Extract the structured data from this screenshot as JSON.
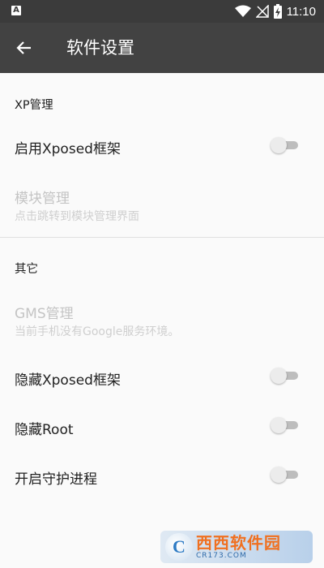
{
  "status_bar": {
    "left_icon_label": "A",
    "time": "11:10",
    "icons": [
      "wifi-icon",
      "signal-off-icon",
      "battery-charging-icon"
    ]
  },
  "toolbar": {
    "back_icon": "arrow-left-icon",
    "title": "软件设置"
  },
  "sections": [
    {
      "header": "XP管理",
      "items": [
        {
          "title": "启用Xposed框架",
          "type": "switch",
          "checked": false,
          "enabled": true
        },
        {
          "title": "模块管理",
          "subtitle": "点击跳转到模块管理界面",
          "type": "link",
          "enabled": false
        }
      ]
    },
    {
      "header": "其它",
      "items": [
        {
          "title": "GMS管理",
          "subtitle": "当前手机没有Google服务环境。",
          "type": "link",
          "enabled": false
        },
        {
          "title": "隐藏Xposed框架",
          "type": "switch",
          "checked": false,
          "enabled": true
        },
        {
          "title": "隐藏Root",
          "type": "switch",
          "checked": false,
          "enabled": true
        },
        {
          "title": "开启守护进程",
          "type": "switch",
          "checked": false,
          "enabled": true
        }
      ]
    }
  ],
  "watermark": {
    "logo_letter": "C",
    "text": "西西软件园",
    "domain": "CR173.COM"
  },
  "colors": {
    "status_bar": "#3b3b3b",
    "toolbar": "#424242",
    "background": "#fafafa",
    "disabled_text": "#c4c4c4",
    "switch_track": "#bdbdbd"
  }
}
